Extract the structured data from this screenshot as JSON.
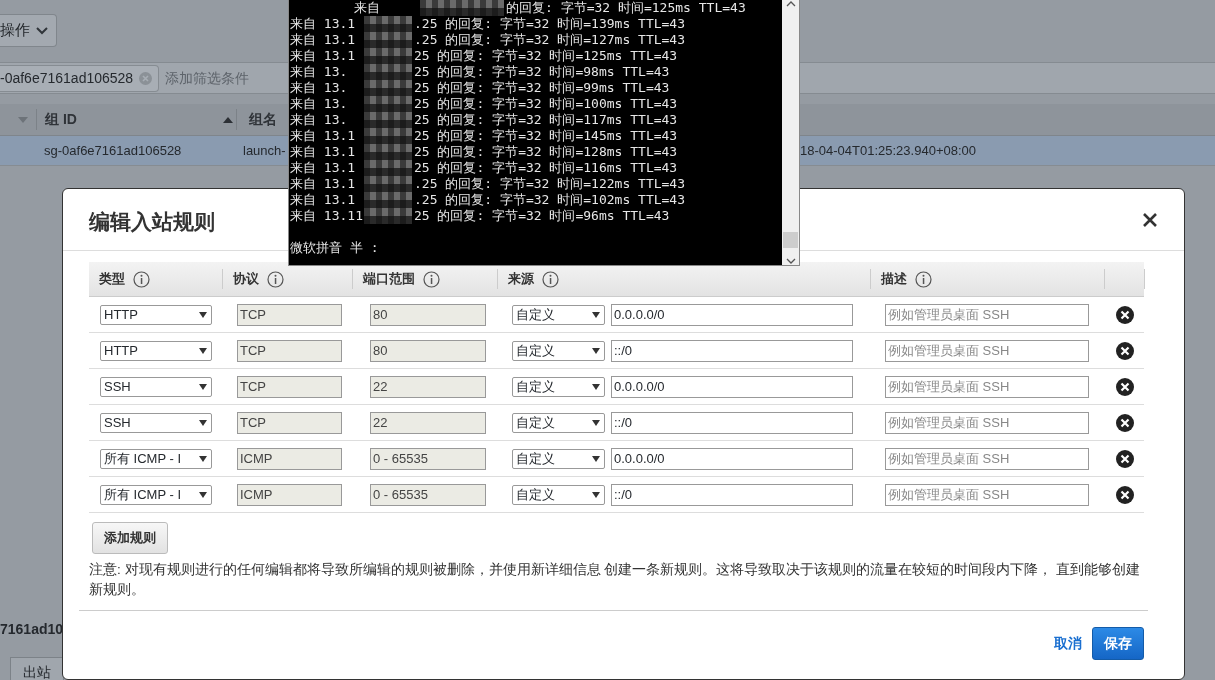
{
  "background": {
    "action_button": "操作",
    "filter_tag": "-0af6e7161ad106528",
    "filter_placeholder": "添加筛选条件",
    "columns": [
      "组 ID",
      "组名"
    ],
    "row": {
      "group_id": "sg-0af6e7161ad106528",
      "group_name": "launch-",
      "column_3": "18-04-04T01:25:23.940+08:00",
      "selected": true
    },
    "lower_text": "7161ad10",
    "lower_tab": "出站"
  },
  "terminal": {
    "lines": [
      {
        "kind": "offset",
        "prefix": "来自",
        "suffix": "的回复: 字节=32 时间=125ms TTL=43"
      },
      {
        "kind": "full",
        "prefix": "来自 13.1",
        "suffix": ".25 的回复: 字节=32 时间=139ms TTL=43"
      },
      {
        "kind": "full",
        "prefix": "来自 13.1",
        "suffix": ".25 的回复: 字节=32 时间=127ms TTL=43"
      },
      {
        "kind": "full",
        "prefix": "来自 13.1",
        "suffix": "25 的回复: 字节=32 时间=125ms TTL=43"
      },
      {
        "kind": "full",
        "prefix": "来自 13.",
        "suffix": "25 的回复: 字节=32 时间=98ms TTL=43"
      },
      {
        "kind": "full",
        "prefix": "来自 13.",
        "suffix": "25 的回复: 字节=32 时间=99ms TTL=43"
      },
      {
        "kind": "full",
        "prefix": "来自 13.",
        "suffix": "25 的回复: 字节=32 时间=100ms TTL=43"
      },
      {
        "kind": "full",
        "prefix": "来自 13.",
        "suffix": "25 的回复: 字节=32 时间=117ms TTL=43"
      },
      {
        "kind": "full",
        "prefix": "来自 13.1",
        "suffix": "25 的回复: 字节=32 时间=145ms TTL=43"
      },
      {
        "kind": "full",
        "prefix": "来自 13.1",
        "suffix": "25 的回复: 字节=32 时间=128ms TTL=43"
      },
      {
        "kind": "full",
        "prefix": "来自 13.1",
        "suffix": "25 的回复: 字节=32 时间=116ms TTL=43"
      },
      {
        "kind": "full",
        "prefix": "来自 13.1",
        "suffix": ".25 的回复: 字节=32 时间=122ms TTL=43"
      },
      {
        "kind": "full",
        "prefix": "来自 13.1",
        "suffix": ".25 的回复: 字节=32 时间=102ms TTL=43"
      },
      {
        "kind": "full",
        "prefix": "来自 13.11",
        "suffix": "25 的回复: 字节=32 时间=96ms TTL=43"
      }
    ],
    "input_line": "微软拼音 半 :"
  },
  "dialog": {
    "title": "编辑入站规则",
    "columns": [
      "类型",
      "协议",
      "端口范围",
      "来源",
      "描述"
    ],
    "rules": [
      {
        "type": "HTTP",
        "protocol": "TCP",
        "port_range": "80",
        "source": "自定义",
        "cidr": "0.0.0.0/0",
        "description_placeholder": "例如管理员桌面 SSH"
      },
      {
        "type": "HTTP",
        "protocol": "TCP",
        "port_range": "80",
        "source": "自定义",
        "cidr": "::/0",
        "description_placeholder": "例如管理员桌面 SSH"
      },
      {
        "type": "SSH",
        "protocol": "TCP",
        "port_range": "22",
        "source": "自定义",
        "cidr": "0.0.0.0/0",
        "description_placeholder": "例如管理员桌面 SSH"
      },
      {
        "type": "SSH",
        "protocol": "TCP",
        "port_range": "22",
        "source": "自定义",
        "cidr": "::/0",
        "description_placeholder": "例如管理员桌面 SSH"
      },
      {
        "type": "所有 ICMP - I",
        "protocol": "ICMP",
        "port_range": "0 - 65535",
        "source": "自定义",
        "cidr": "0.0.0.0/0",
        "description_placeholder": "例如管理员桌面 SSH"
      },
      {
        "type": "所有 ICMP - I",
        "protocol": "ICMP",
        "port_range": "0 - 65535",
        "source": "自定义",
        "cidr": "::/0",
        "description_placeholder": "例如管理员桌面 SSH"
      }
    ],
    "add_rule_button": "添加规则",
    "note": "注意: 对现有规则进行的任何编辑都将导致所编辑的规则被删除，并使用新详细信息 创建一条新规则。这将导致取决于该规则的流量在较短的时间段内下降， 直到能够创建新规则。",
    "cancel": "取消",
    "save": "保存"
  }
}
